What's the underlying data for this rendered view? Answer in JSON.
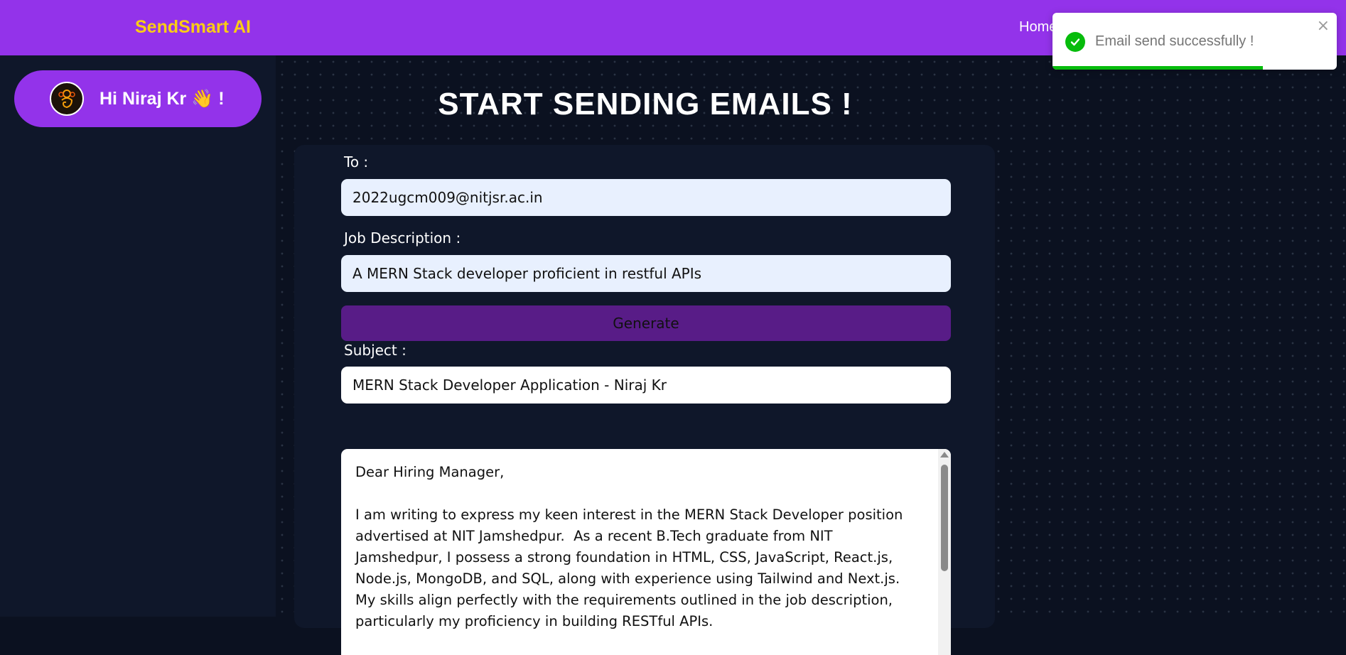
{
  "app": {
    "brand": "SendSmart AI",
    "nav_home": "Home"
  },
  "sidebar": {
    "greeting": "Hi Niraj Kr 👋 !",
    "avatar_icon": "lord-ganesha-icon"
  },
  "main": {
    "title": "START SENDING EMAILS !"
  },
  "form": {
    "to_label": "To :",
    "to_value": "2022ugcm009@nitjsr.ac.in",
    "job_label": "Job Description :",
    "job_value": "A MERN Stack developer proficient in restful APIs",
    "generate_label": "Generate",
    "subject_label": "Subject :",
    "subject_value": "MERN Stack Developer Application - Niraj Kr",
    "body_value": "Dear Hiring Manager,\n\nI am writing to express my keen interest in the MERN Stack Developer position advertised at NIT Jamshedpur.  As a recent B.Tech graduate from NIT Jamshedpur, I possess a strong foundation in HTML, CSS, JavaScript, React.js, Node.js, MongoDB, and SQL, along with experience using Tailwind and Next.js.  My skills align perfectly with the requirements outlined in the job description, particularly my proficiency in building RESTful APIs."
  },
  "toast": {
    "message": "Email send successfully !",
    "close": "×",
    "progress": 0.74,
    "icon": "check-circle-icon"
  },
  "colors": {
    "navbar": "#9333ea",
    "brand": "#facc15",
    "background": "#0b1120",
    "card": "#0f172a",
    "generate_button": "#581c87",
    "success": "#07bc0c"
  }
}
